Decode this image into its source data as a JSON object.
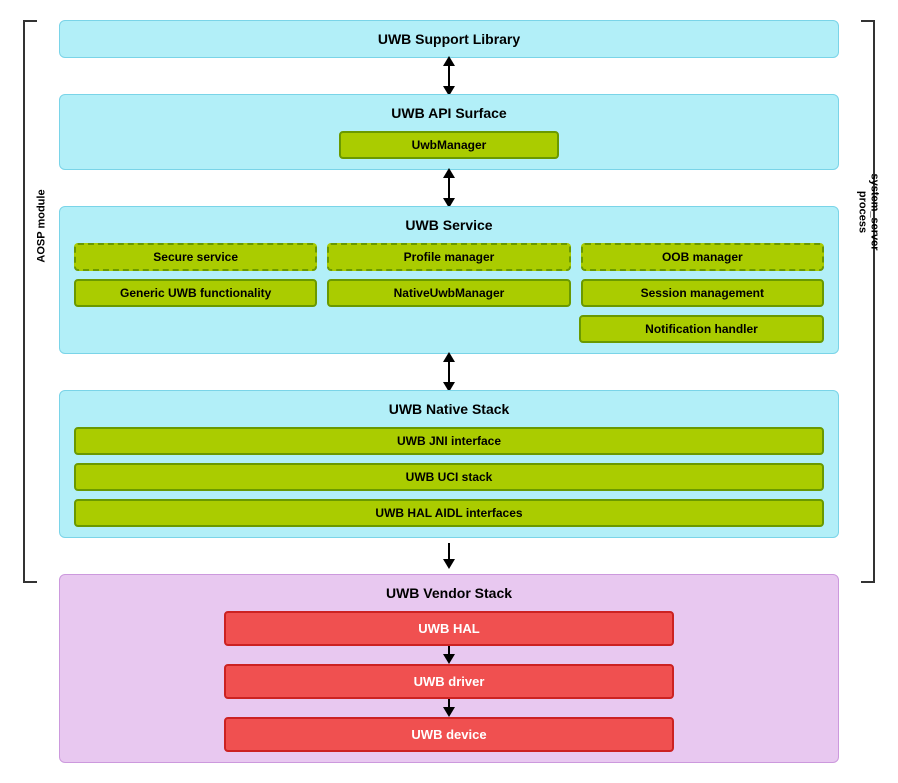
{
  "diagram": {
    "aosp_label": "AOSP module",
    "system_server_label": "system_server",
    "system_server_sub": "process",
    "support_library": {
      "title": "UWB Support Library"
    },
    "api_surface": {
      "title": "UWB API Surface",
      "inner": "UwbManager"
    },
    "uwb_service": {
      "title": "UWB Service",
      "row1": [
        "Secure service",
        "Profile manager",
        "OOB manager"
      ],
      "row2": [
        "Generic UWB functionality",
        "NativeUwbManager",
        "Session management"
      ],
      "row3_right": "Notification handler"
    },
    "uwb_native": {
      "title": "UWB Native Stack",
      "items": [
        "UWB JNI interface",
        "UWB UCI stack",
        "UWB HAL AIDL interfaces"
      ]
    },
    "vendor_stack": {
      "title": "UWB Vendor Stack",
      "items": [
        "UWB HAL",
        "UWB driver",
        "UWB device"
      ]
    }
  }
}
